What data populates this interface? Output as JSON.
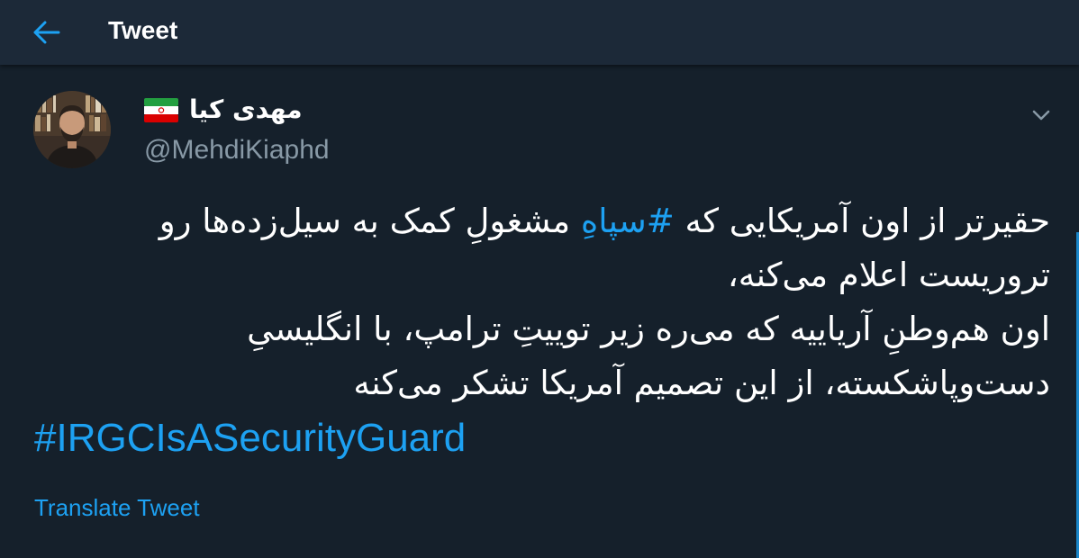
{
  "header": {
    "title": "Tweet",
    "back_icon": "arrow-left-icon"
  },
  "tweet": {
    "author": {
      "display_name": "مهدی کیا",
      "flag_icon": "iran-flag-icon",
      "handle": "@MehdiKiaphd",
      "avatar_icon": "avatar-photo"
    },
    "menu_icon": "chevron-down-icon",
    "body": {
      "line1_part1": "حقیرتر از اون آمریکایی که ",
      "line1_hashtag": "#سپاهِ",
      "line1_part2": " مشغولِ کمک به سیل‌زده‌ها رو",
      "line2": "تروریست اعلام می‌کنه،",
      "line3": "اون هم‌وطنِ آریاییه که می‌ره زیر توییتِ ترامپ، با انگلیسیِ",
      "line4": "دست‌وپاشکسته، از این تصمیم آمریکا تشکر می‌کنه"
    },
    "hashtag_en": "#IRGCIsASecurityGuard",
    "translate_label": "Translate Tweet"
  },
  "colors": {
    "background": "#15202b",
    "header_bg": "#1c2938",
    "accent": "#1da1f2",
    "secondary_text": "#8899a6"
  }
}
